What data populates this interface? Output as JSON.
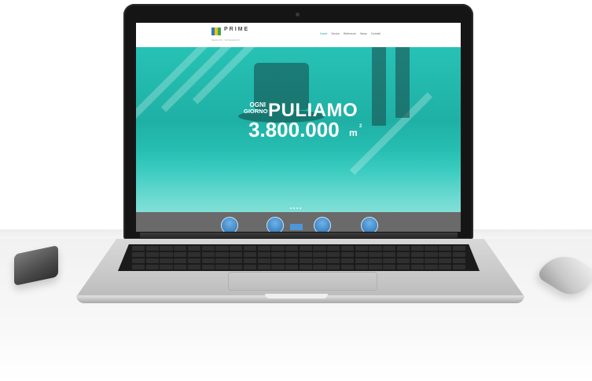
{
  "site": {
    "brand": "PRIME",
    "tagline": "SERVIZI INTEGRATI",
    "nav": [
      {
        "label": "Home",
        "active": true
      },
      {
        "label": "Servizi"
      },
      {
        "label": "Referenze"
      },
      {
        "label": "News"
      },
      {
        "label": "Contatti"
      }
    ]
  },
  "hero": {
    "small_line_1": "OGNI",
    "small_line_2": "GIORNO",
    "headline": "PULIAMO",
    "number": "3.800.000",
    "unit": "m",
    "unit_sup": "2",
    "slide_dots": 4
  },
  "lower_strip": {
    "icons": [
      "service-circle-icon",
      "service-circle-icon",
      "service-square-icon",
      "service-circle-icon",
      "service-circle-icon"
    ]
  },
  "colors": {
    "hero_teal": "#1fb0a5",
    "accent": "#1aa79d",
    "strip_gray": "#6a6a6a",
    "icon_blue": "#2a6fb0"
  }
}
